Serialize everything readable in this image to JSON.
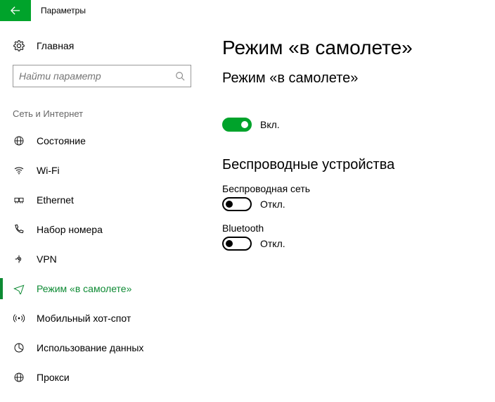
{
  "titlebar": {
    "title": "Параметры"
  },
  "sidebar": {
    "home": "Главная",
    "search_placeholder": "Найти параметр",
    "section": "Сеть и Интернет",
    "items": [
      {
        "label": "Состояние"
      },
      {
        "label": "Wi-Fi"
      },
      {
        "label": "Ethernet"
      },
      {
        "label": "Набор номера"
      },
      {
        "label": "VPN"
      },
      {
        "label": "Режим «в самолете»"
      },
      {
        "label": "Мобильный хот-спот"
      },
      {
        "label": "Использование данных"
      },
      {
        "label": "Прокси"
      }
    ]
  },
  "main": {
    "title": "Режим «в самолете»",
    "subtitle": "Режим «в самолете»",
    "airplane": {
      "state_label": "Вкл."
    },
    "wireless_heading": "Беспроводные устройства",
    "wifi": {
      "label": "Беспроводная сеть",
      "state_label": "Откл."
    },
    "bluetooth": {
      "label": "Bluetooth",
      "state_label": "Откл."
    }
  }
}
